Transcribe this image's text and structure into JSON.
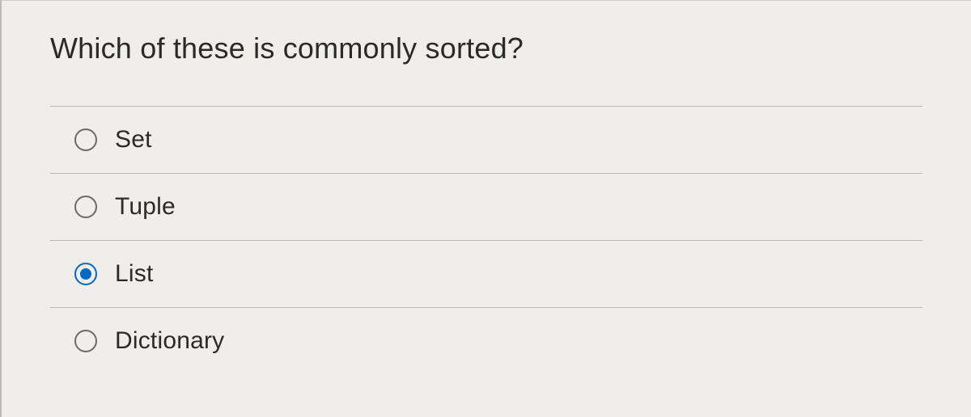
{
  "question": {
    "text": "Which of these is commonly sorted?"
  },
  "options": [
    {
      "label": "Set",
      "selected": false
    },
    {
      "label": "Tuple",
      "selected": false
    },
    {
      "label": "List",
      "selected": true
    },
    {
      "label": "Dictionary",
      "selected": false
    }
  ]
}
